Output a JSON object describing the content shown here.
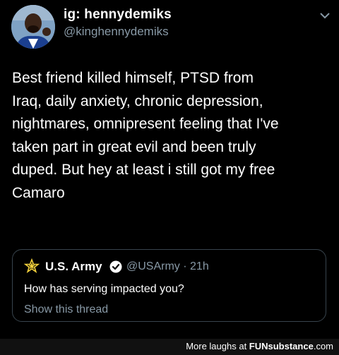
{
  "tweet": {
    "display_name": "ig: hennydemiks",
    "handle": "@kinghennydemiks",
    "avatar_icon": "profile-photo",
    "caret_icon": "chevron-down-icon",
    "body": "Best friend killed himself, PTSD from\nIraq, daily anxiety, chronic depression,\nnightmares, omnipresent feeling that I've\ntaken part in great evil and been truly\nduped. But hey at least i still got my free\nCamaro"
  },
  "quoted_tweet": {
    "name": "U.S. Army",
    "logo_icon": "army-star-logo",
    "verified_icon": "verified-badge-icon",
    "handle_time": "@USArmy · 21h",
    "text": "How has serving impacted you?",
    "show_thread": "Show this thread"
  },
  "footer": {
    "prefix": "More laughs at ",
    "brand": "FUNsubstance",
    "suffix": ".com"
  }
}
